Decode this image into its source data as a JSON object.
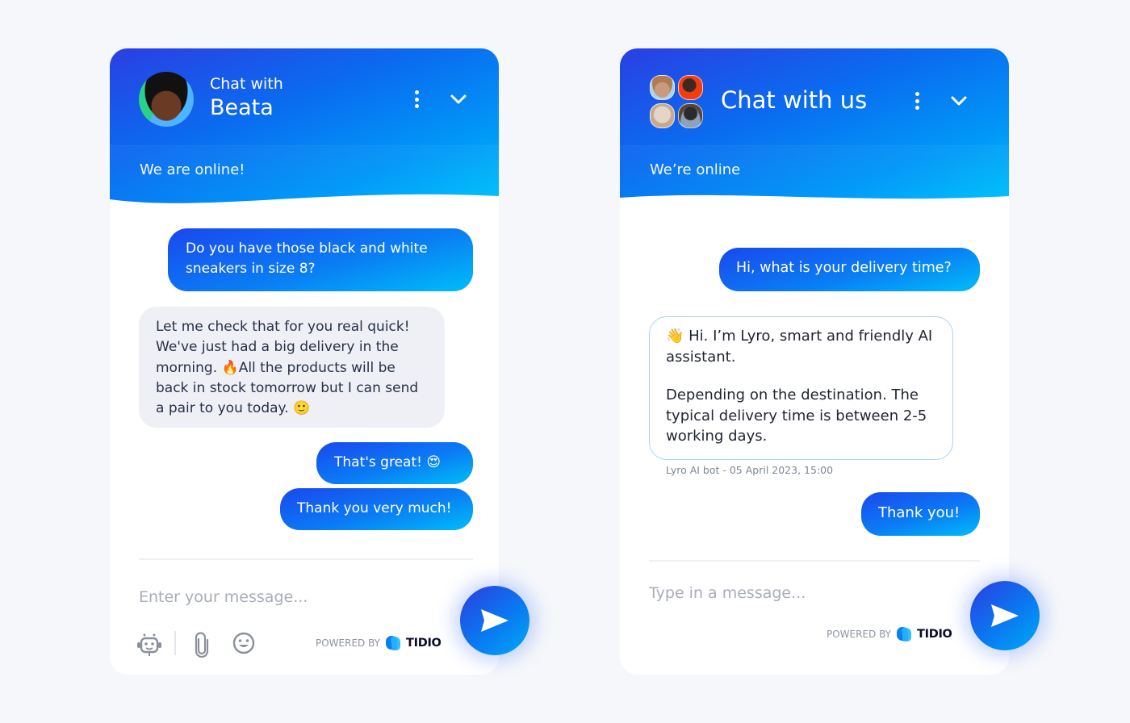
{
  "colors": {
    "background": "#f5f7fa",
    "accent_gradient_start": "#2a3fe3",
    "accent_gradient_end": "#00c4fb",
    "incoming_bubble": "#eef0f6",
    "bot_bubble_border": "#a9d2f3"
  },
  "widget_left": {
    "header": {
      "title_small": "Chat with",
      "title_name": "Beata",
      "status": "We are online!",
      "menu_icon": "kebab-menu-icon",
      "minimize_icon": "chevron-down-icon"
    },
    "messages": [
      {
        "from": "visitor",
        "text": "Do you have those black and white sneakers in size 8?"
      },
      {
        "from": "agent",
        "text": "Let me check that for you real quick! We've just had a big delivery in the morning. 🔥All the products will be back in stock tomorrow but I can send a pair to you today. 🙂"
      },
      {
        "from": "visitor",
        "text": "That's great! 😍"
      },
      {
        "from": "visitor",
        "text": "Thank you very much!"
      }
    ],
    "composer": {
      "placeholder": "Enter your message...",
      "tools": [
        "bot-icon",
        "attachment-icon",
        "emoji-icon"
      ]
    },
    "footer": {
      "powered_by": "POWERED BY",
      "brand": "TIDIO"
    },
    "send_icon": "send-icon"
  },
  "widget_right": {
    "header": {
      "title": "Chat with us",
      "status": "We’re online",
      "menu_icon": "kebab-menu-icon",
      "minimize_icon": "chevron-down-icon"
    },
    "messages": [
      {
        "from": "visitor",
        "text": "Hi, what is your delivery time?"
      },
      {
        "from": "bot",
        "line1": "👋 Hi. I’m Lyro, smart and friendly AI assistant.",
        "line2": "Depending on the destination. The typical delivery time is between 2-5 working days.",
        "meta": "Lyro AI bot - 05 April 2023, 15:00"
      },
      {
        "from": "visitor",
        "text": "Thank you!"
      }
    ],
    "composer": {
      "placeholder": "Type in a message..."
    },
    "footer": {
      "powered_by": "POWERED BY",
      "brand": "TIDIO"
    },
    "send_icon": "send-icon"
  }
}
